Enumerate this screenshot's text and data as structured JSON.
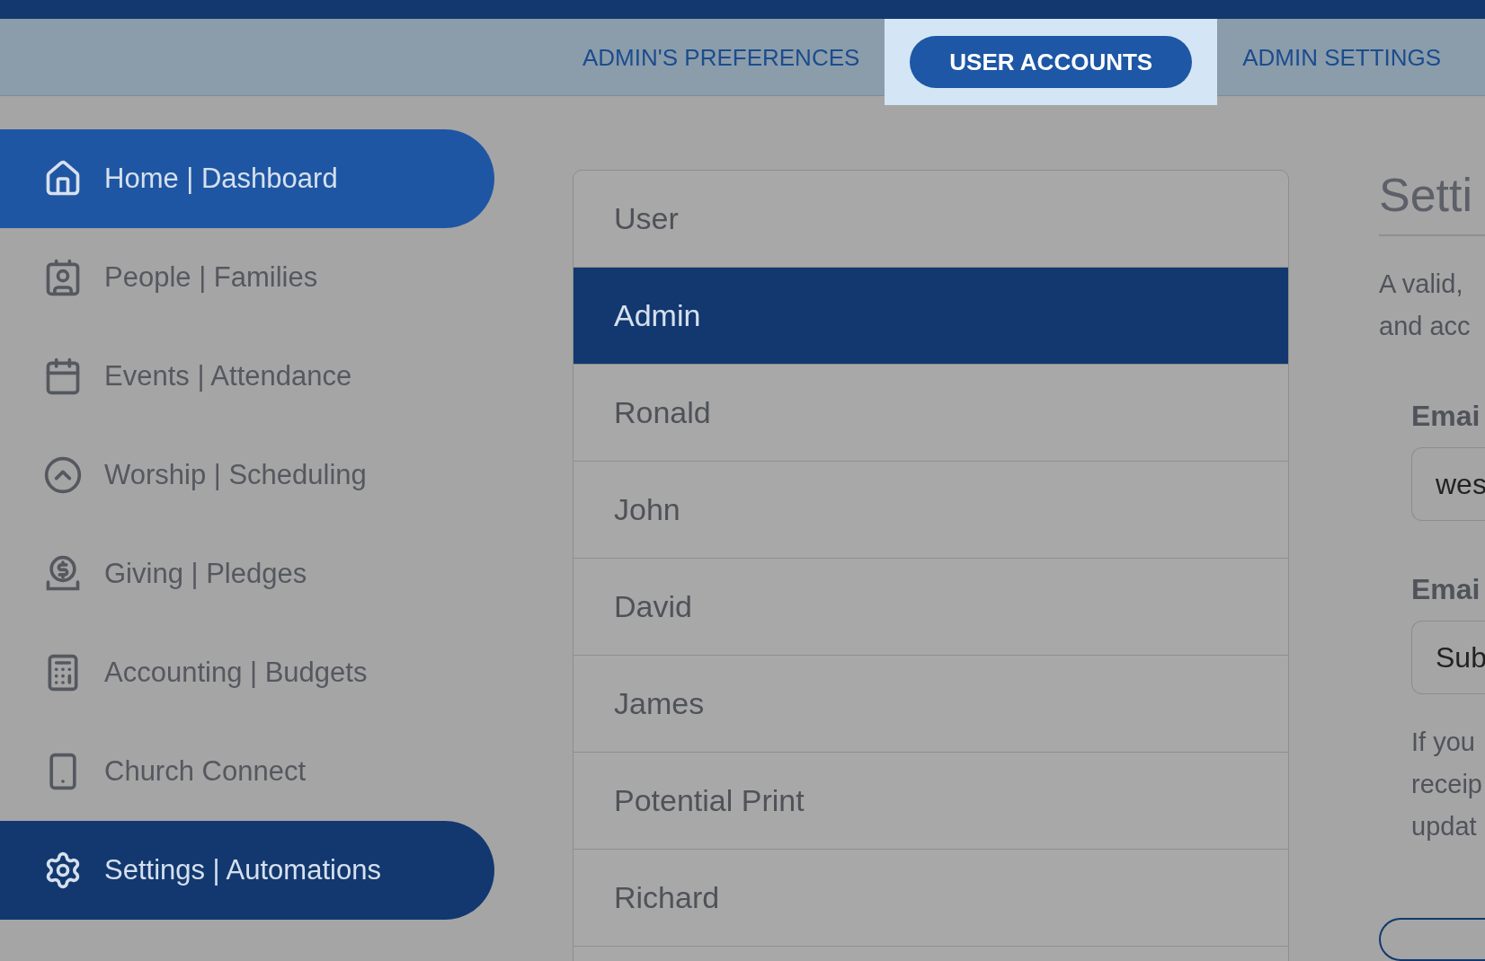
{
  "tabs": [
    {
      "label": "ADMIN'S PREFERENCES",
      "selected": false
    },
    {
      "label": "USER ACCOUNTS",
      "selected": true
    },
    {
      "label": "ADMIN SETTINGS",
      "selected": false
    }
  ],
  "sidebar": {
    "items": [
      {
        "label": "Home | Dashboard",
        "hovered": true,
        "selected": false
      },
      {
        "label": "People | Families",
        "hovered": false,
        "selected": false
      },
      {
        "label": "Events | Attendance",
        "hovered": false,
        "selected": false
      },
      {
        "label": "Worship | Scheduling",
        "hovered": false,
        "selected": false
      },
      {
        "label": "Giving | Pledges",
        "hovered": false,
        "selected": false
      },
      {
        "label": "Accounting | Budgets",
        "hovered": false,
        "selected": false
      },
      {
        "label": "Church Connect",
        "hovered": false,
        "selected": false
      },
      {
        "label": "Settings | Automations",
        "hovered": false,
        "selected": true
      }
    ]
  },
  "users": [
    {
      "name": "User",
      "selected": false
    },
    {
      "name": "Admin",
      "selected": true
    },
    {
      "name": "Ronald",
      "selected": false
    },
    {
      "name": "John",
      "selected": false
    },
    {
      "name": "David",
      "selected": false
    },
    {
      "name": "James",
      "selected": false
    },
    {
      "name": "Potential Print",
      "selected": false
    },
    {
      "name": "Richard",
      "selected": false
    }
  ],
  "settings": {
    "title": "Setti",
    "description": [
      "A valid,",
      "and acc"
    ],
    "fields": [
      {
        "label": "Emai",
        "value": "wes"
      },
      {
        "label": "Emai",
        "value": "Sub"
      }
    ],
    "note": [
      "If you",
      "receip",
      "updat"
    ]
  }
}
